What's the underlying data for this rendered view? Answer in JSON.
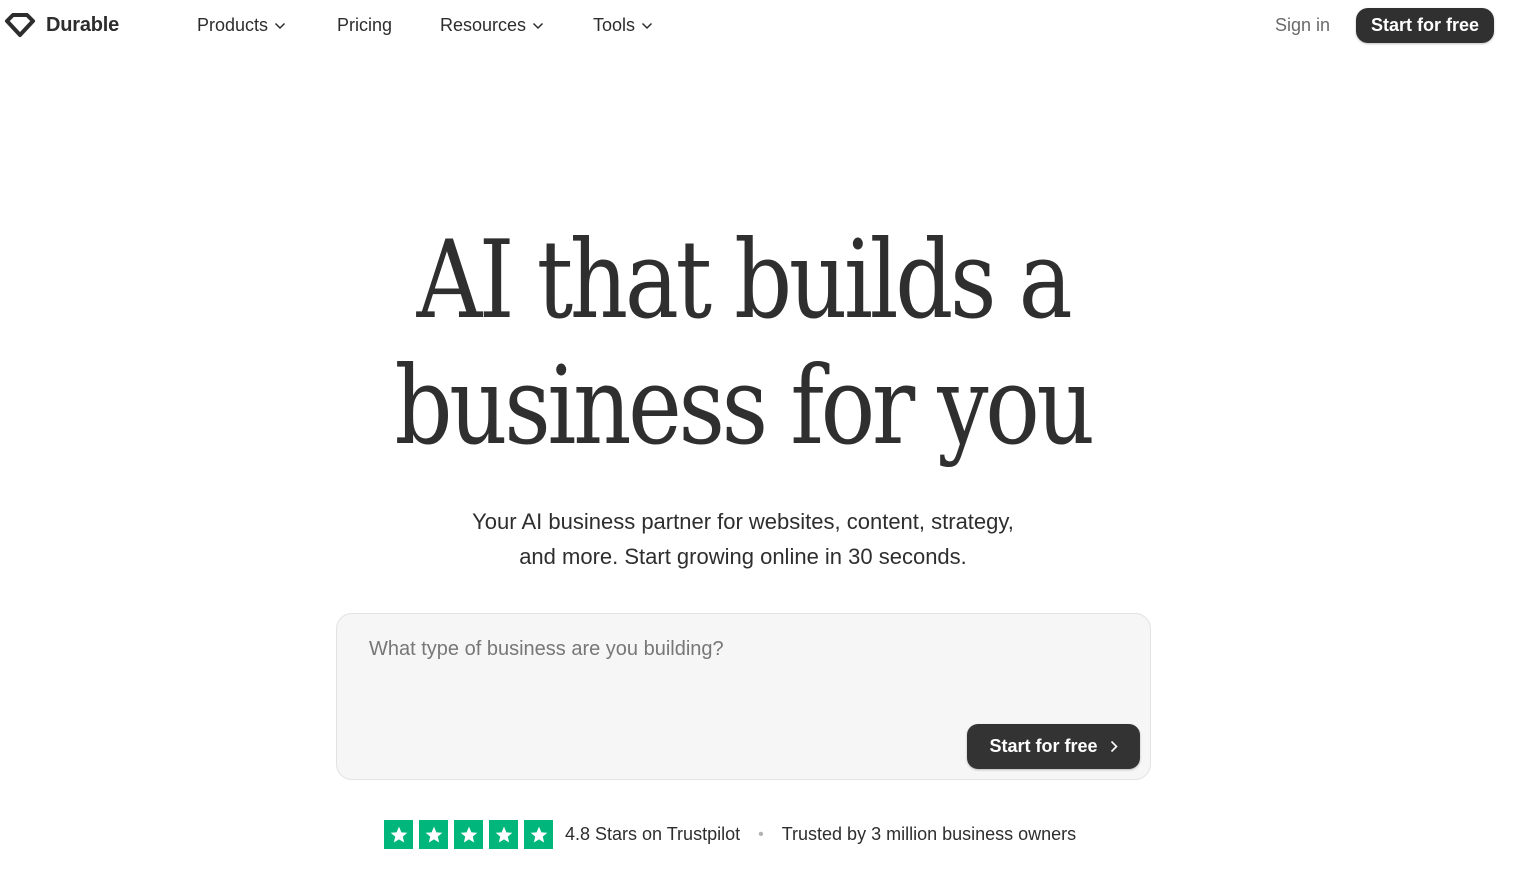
{
  "brand": {
    "name": "Durable",
    "logo_icon": "diamond-logo-icon"
  },
  "nav": {
    "items": [
      {
        "label": "Products",
        "has_dropdown": true
      },
      {
        "label": "Pricing",
        "has_dropdown": false
      },
      {
        "label": "Resources",
        "has_dropdown": true
      },
      {
        "label": "Tools",
        "has_dropdown": true
      }
    ],
    "sign_in": "Sign in",
    "cta": "Start for free"
  },
  "hero": {
    "headline_line1": "AI that builds a",
    "headline_line2": "business for you",
    "subtitle_line1": "Your AI business partner for websites, content, strategy,",
    "subtitle_line2": "and more. Start growing online in 30 seconds."
  },
  "prompt": {
    "placeholder": "What type of business are you building?",
    "value": "",
    "cta": "Start for free",
    "cta_icon": "chevron-right-icon"
  },
  "trust": {
    "star_count": 5,
    "rating_text": "4.8 Stars on Trustpilot",
    "separator": "•",
    "trusted_text": "Trusted by 3 million business owners"
  },
  "colors": {
    "text": "#2e2e2e",
    "button_bg": "#303030",
    "button_text": "#ffffff",
    "input_bg": "#f6f6f6",
    "trustpilot_green": "#00b67a"
  }
}
